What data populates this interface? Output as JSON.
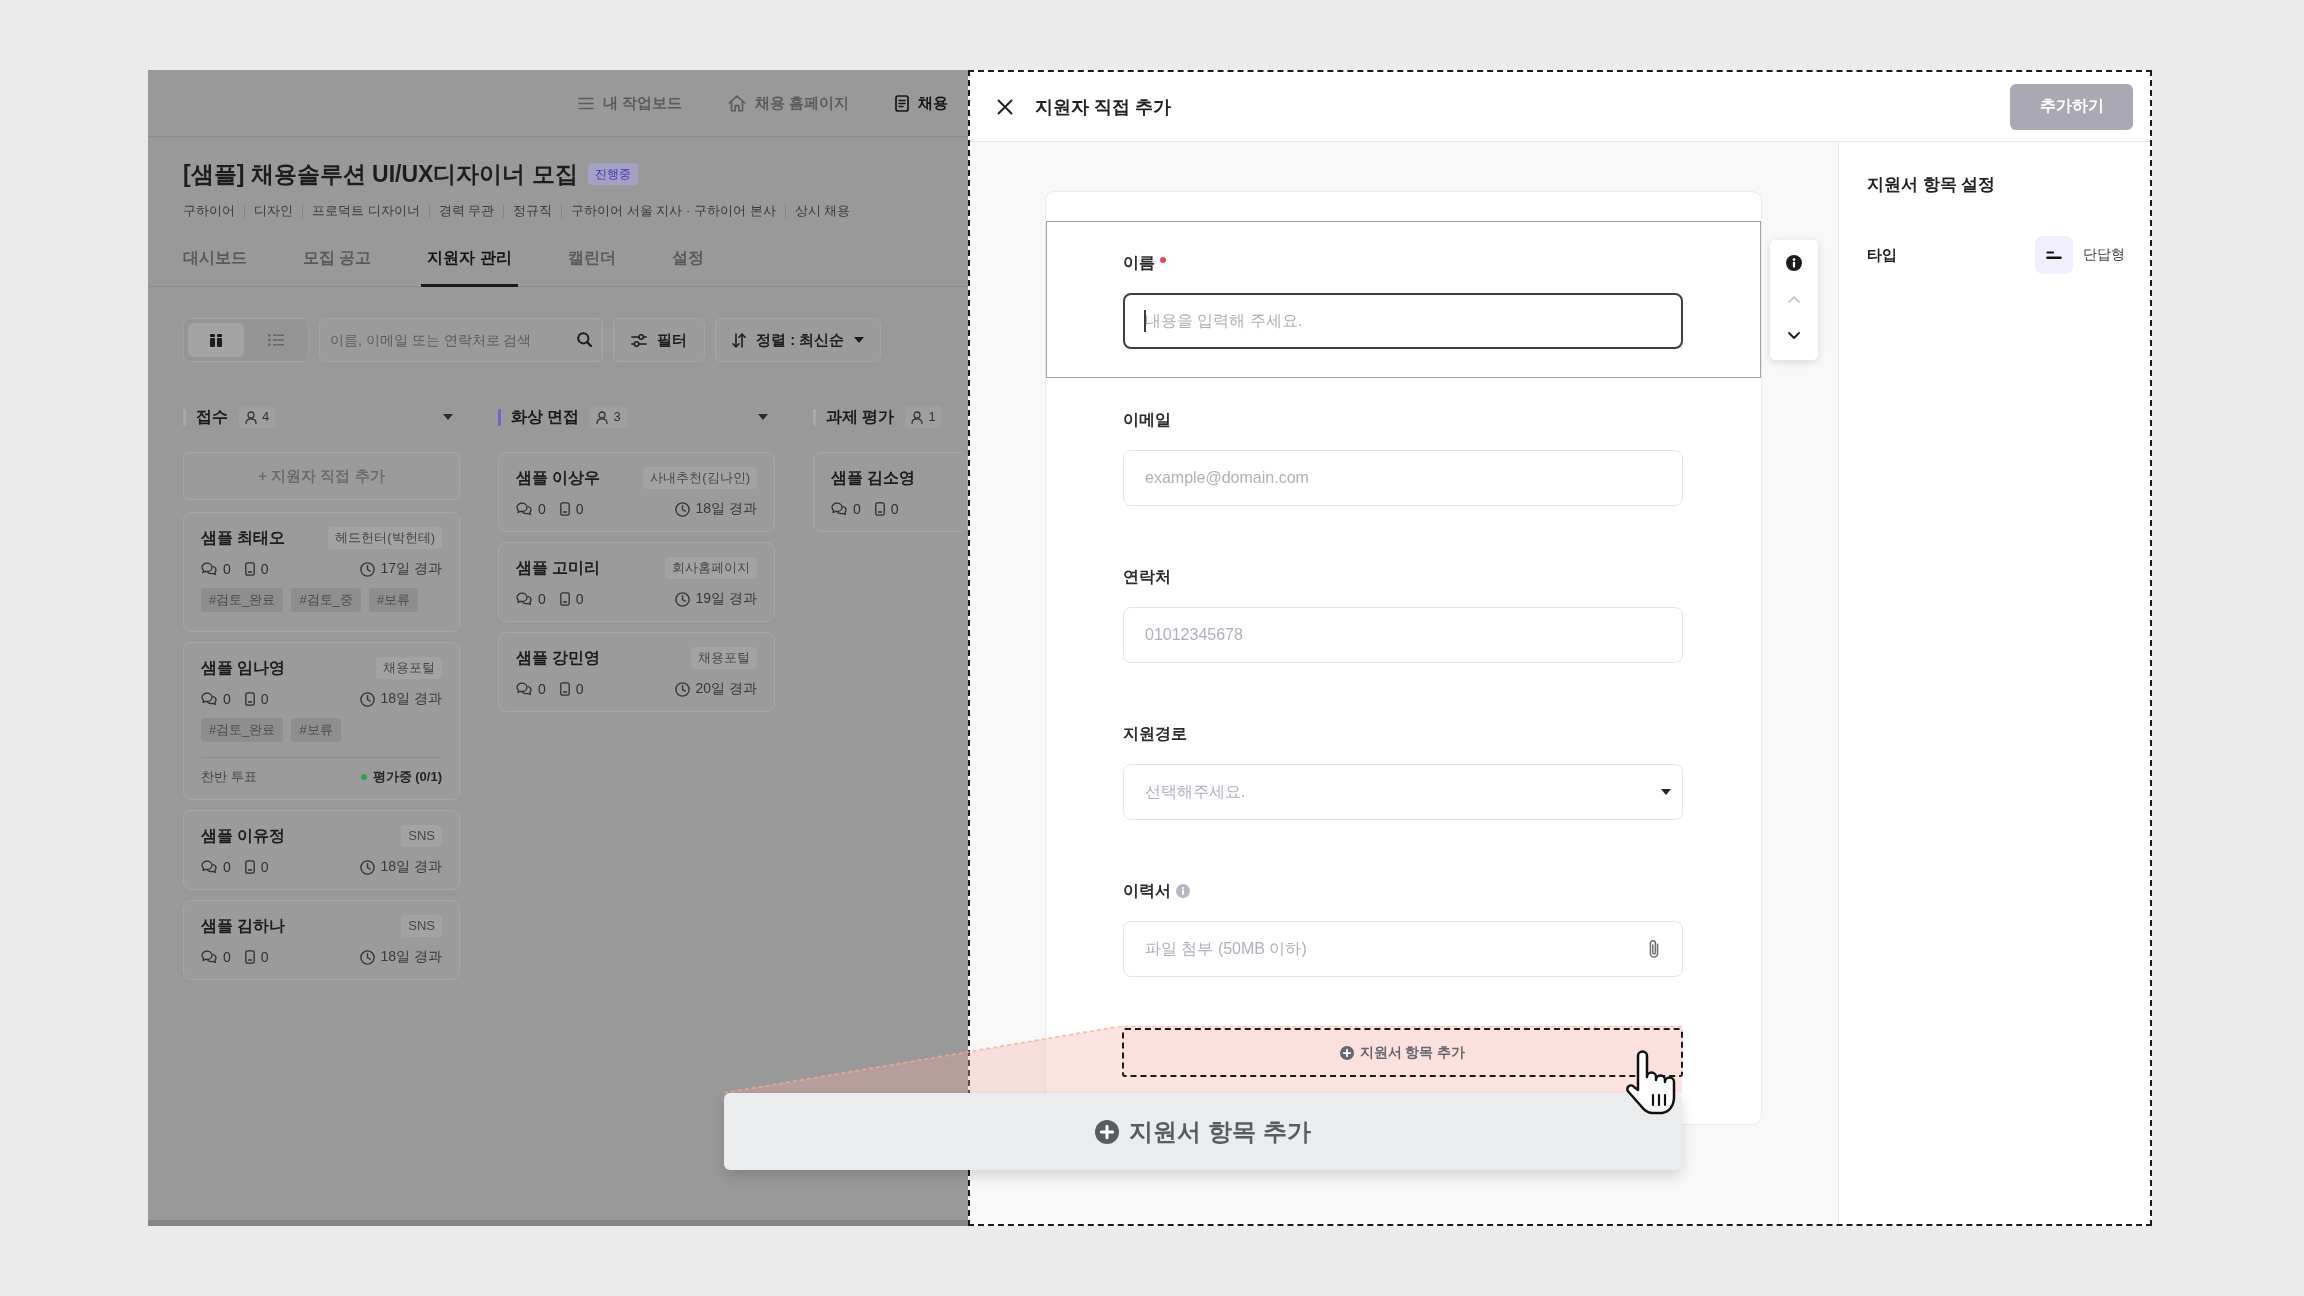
{
  "top_nav": [
    {
      "label": "내 작업보드",
      "selected": false
    },
    {
      "label": "채용 홈페이지",
      "selected": false
    },
    {
      "label": "채용",
      "selected": true
    }
  ],
  "posting": {
    "title": "[샘플] 채용솔루션 UI/UX디자이너 모집",
    "status": "진행중",
    "meta": [
      "구하이어",
      "디자인",
      "프로덕트 디자이너",
      "경력 무관",
      "정규직",
      "구하이어 서울 지사 · 구하이어 본사",
      "상시 채용"
    ]
  },
  "tabs": [
    {
      "label": "대시보드",
      "selected": false
    },
    {
      "label": "모집 공고",
      "selected": false
    },
    {
      "label": "지원자 관리",
      "selected": true
    },
    {
      "label": "캘린더",
      "selected": false
    },
    {
      "label": "설정",
      "selected": false
    }
  ],
  "toolbar": {
    "views": [
      {
        "selected": true
      },
      {
        "selected": false
      }
    ],
    "search": {
      "placeholder": "이름, 이메일 또는 연락처로 검색"
    },
    "filter": "필터",
    "sort": "정렬 : 최신순"
  },
  "board": {
    "columns": [
      {
        "title": "접수",
        "count": "4",
        "color": "#a9a9a9",
        "dropdown": true,
        "add_button": "+ 지원자 직접 추가",
        "cards": [
          {
            "name": "샘플 최태오",
            "source": "헤드헌터(박헌테)",
            "stats": [
              "0",
              "0"
            ],
            "elapsed": "17일 경과",
            "tags": [
              "#검토_완료",
              "#검토_중",
              "#보류"
            ]
          },
          {
            "name": "샘플 임나영",
            "source": "채용포털",
            "stats": [
              "0",
              "0"
            ],
            "elapsed": "18일 경과",
            "tags": [
              "#검토_완료",
              "#보류"
            ],
            "vote": {
              "label": "찬반 투표",
              "status": "평가중 (0/1)"
            }
          },
          {
            "name": "샘플 이유정",
            "source": "SNS",
            "stats": [
              "0",
              "0"
            ],
            "elapsed": "18일 경과"
          },
          {
            "name": "샘플 김하나",
            "source": "SNS",
            "stats": [
              "0",
              "0"
            ],
            "elapsed": "18일 경과"
          }
        ]
      },
      {
        "title": "화상 면접",
        "count": "3",
        "color": "#7467c4",
        "dropdown": true,
        "cards": [
          {
            "name": "샘플 이상우",
            "source": "사내추천(김나인)",
            "stats": [
              "0",
              "0"
            ],
            "elapsed": "18일 경과"
          },
          {
            "name": "샘플 고미리",
            "source": "회사홈페이지",
            "stats": [
              "0",
              "0"
            ],
            "elapsed": "19일 경과"
          },
          {
            "name": "샘플 강민영",
            "source": "채용포털",
            "stats": [
              "0",
              "0"
            ],
            "elapsed": "20일 경과"
          }
        ]
      },
      {
        "title": "과제 평가",
        "count": "1",
        "color": "#a9a9a9",
        "dropdown": false,
        "cards": [
          {
            "name": "샘플 김소영",
            "stats": [
              "0",
              "0"
            ]
          }
        ]
      }
    ]
  },
  "modal": {
    "title": "지원자 직접 추가",
    "submit": {
      "label": "추가하기",
      "disabled": true
    },
    "fields": [
      {
        "kind": "text",
        "label": "이름",
        "required": true,
        "info": false,
        "placeholder": "내용을 입력해 주세요.",
        "selected": true
      },
      {
        "kind": "text",
        "label": "이메일",
        "required": false,
        "info": false,
        "placeholder": "example@domain.com",
        "selected": false
      },
      {
        "kind": "text",
        "label": "연락처",
        "required": false,
        "info": false,
        "placeholder": "01012345678",
        "selected": false
      },
      {
        "kind": "select",
        "label": "지원경로",
        "required": false,
        "info": false,
        "placeholder": "선택해주세요.",
        "selected": false
      },
      {
        "kind": "file",
        "label": "이력서",
        "required": false,
        "info": true,
        "placeholder": "파일 첨부 (50MB 이하)",
        "selected": false
      }
    ],
    "field_tools": [
      {
        "disabled": false
      },
      {
        "disabled": true
      },
      {
        "disabled": false
      }
    ],
    "add_item": "지원서 항목 추가",
    "settings": {
      "title": "지원서 항목 설정",
      "rows": [
        {
          "label": "타입",
          "value": "단답형"
        }
      ]
    }
  },
  "zoom_callout": {
    "label": "지원서 항목 추가"
  }
}
